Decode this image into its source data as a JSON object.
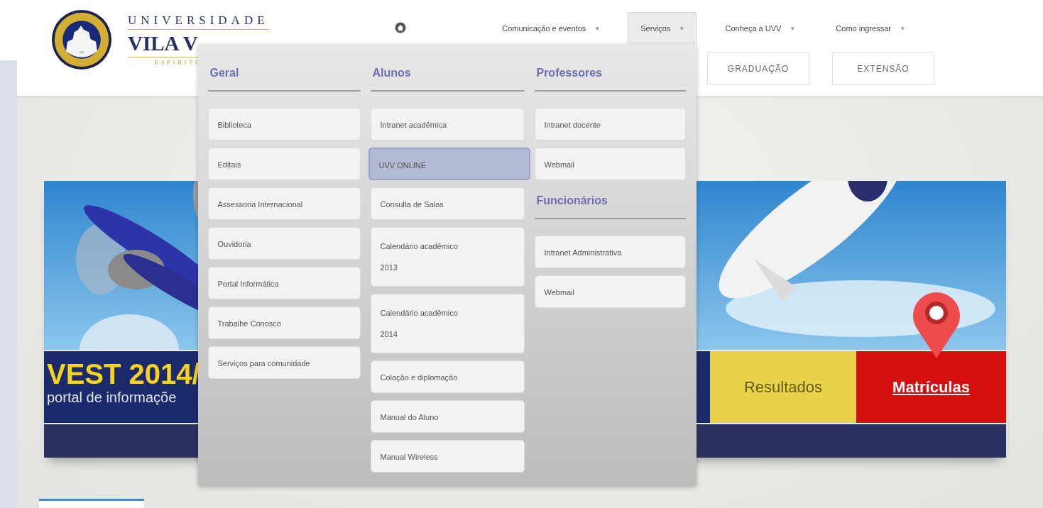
{
  "logo": {
    "line1": "UNIVERSIDADE",
    "line2": "VILA V",
    "line3": "ESPIRITO"
  },
  "nav": [
    {
      "label": "Comunicação e eventos",
      "selected": false,
      "caret": "▾"
    },
    {
      "label": "Serviços",
      "selected": true,
      "caret": "▾"
    },
    {
      "label": "Conheça a UVV",
      "selected": false,
      "caret": "▾"
    },
    {
      "label": "Como ingressar",
      "selected": false,
      "caret": "▾"
    }
  ],
  "quick_links": [
    {
      "label": "GRADUAÇÃO"
    },
    {
      "label": "EXTENSÃO"
    }
  ],
  "dropdown": {
    "columns": [
      {
        "sections": [
          {
            "heading": "Geral",
            "items": [
              {
                "label": "Biblioteca",
                "selected": false
              },
              {
                "label": "Editais",
                "selected": false
              },
              {
                "label": "Assessoria Internacional",
                "selected": false
              },
              {
                "label": "Ouvidoria",
                "selected": false
              },
              {
                "label": "Portal Informática",
                "selected": false
              },
              {
                "label": "Trabalhe Conosco",
                "selected": false
              },
              {
                "label": "Serviços para comunidade",
                "selected": false
              }
            ]
          }
        ]
      },
      {
        "sections": [
          {
            "heading": "Alunos",
            "items": [
              {
                "label": "Intranet acadêmica",
                "selected": false
              },
              {
                "label": "UVV ONLINE",
                "selected": true
              },
              {
                "label": "Consulta de Salas",
                "selected": false
              },
              {
                "label": "Calendário acadêmico\n2013",
                "selected": false
              },
              {
                "label": "Calendário acadêmico\n2014",
                "selected": false
              },
              {
                "label": "Colação e diplomação",
                "selected": false
              },
              {
                "label": "Manual do Aluno",
                "selected": false
              },
              {
                "label": "Manual Wireless",
                "selected": false
              }
            ]
          }
        ]
      },
      {
        "sections": [
          {
            "heading": "Professores",
            "items": [
              {
                "label": "Intranet docente",
                "selected": false
              },
              {
                "label": "Webmail",
                "selected": false
              }
            ]
          },
          {
            "heading": "Funcionários",
            "items": [
              {
                "label": "Intranet Administrativa",
                "selected": false
              },
              {
                "label": "Webmail",
                "selected": false
              }
            ]
          }
        ]
      }
    ]
  },
  "banner": {
    "headline": "VEST 2014/",
    "subtitle": "portal de informaçõe",
    "buttons": [
      {
        "label": "Resultados",
        "color": "#e8d24a",
        "underlined": false
      },
      {
        "label": "Matrículas",
        "color": "#d3100f",
        "underlined": true
      }
    ]
  }
}
